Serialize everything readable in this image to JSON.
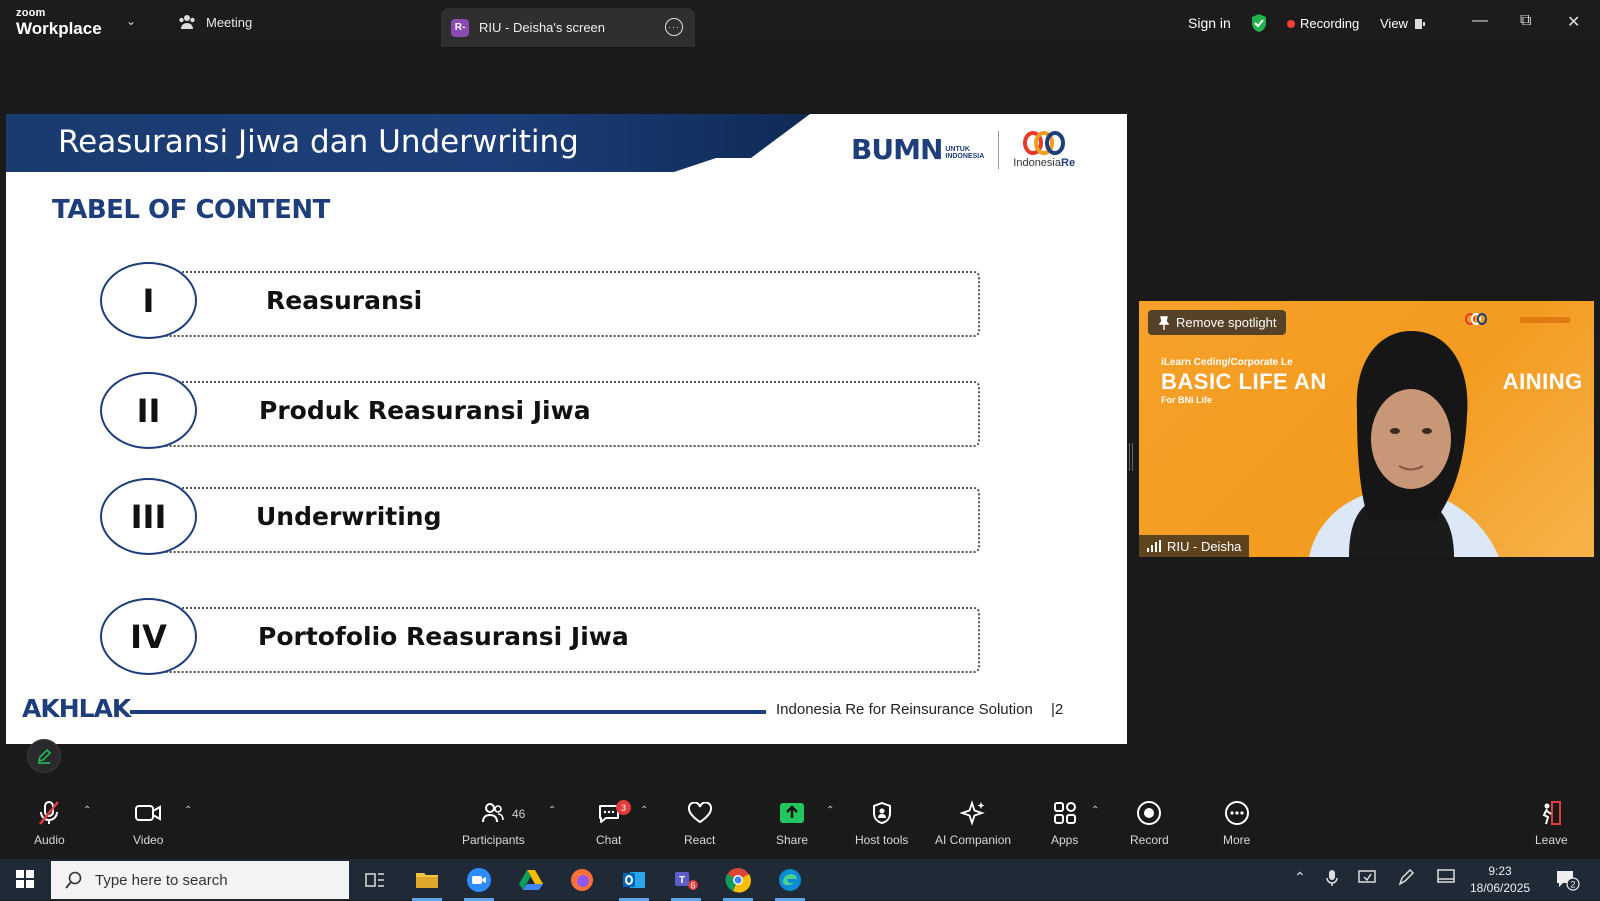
{
  "app": {
    "brand_small": "zoom",
    "brand_name": "Workplace",
    "meeting_tab_label": "Meeting",
    "share_tab_badge": "R-",
    "share_tab_label": "RIU - Deisha's screen",
    "sign_in_label": "Sign in",
    "recording_label": "Recording",
    "view_label": "View"
  },
  "slide": {
    "title": "Reasuransi Jiwa dan Underwriting",
    "logo_bumn": "BUMN",
    "logo_bumn_sub_1": "UNTUK",
    "logo_bumn_sub_2": "INDONESIA",
    "logo_indonesiare_1": "Indonesia",
    "logo_indonesiare_2": "Re",
    "toc_heading": "TABEL OF CONTENT",
    "items": [
      {
        "numeral": "I",
        "label": "Reasuransi"
      },
      {
        "numeral": "II",
        "label": "Produk Reasuransi Jiwa"
      },
      {
        "numeral": "III",
        "label": "Underwriting"
      },
      {
        "numeral": "IV",
        "label": "Portofolio Reasuransi Jiwa"
      }
    ],
    "footer_logo": "AKHLAK",
    "footer_text": "Indonesia Re for Reinsurance Solution",
    "footer_page": "|2"
  },
  "video": {
    "remove_spotlight_label": "Remove spotlight",
    "bg_small": "iLearn Ceding/Corporate Le",
    "bg_big_left": "BASIC LIFE AN",
    "bg_big_right": "AINING",
    "bg_for": "For BNI Life",
    "participant_name": "RIU - Deisha"
  },
  "toolbar": {
    "audio": "Audio",
    "video": "Video",
    "participants": "Participants",
    "participants_count": "46",
    "chat": "Chat",
    "chat_badge": "3",
    "react": "React",
    "share": "Share",
    "host_tools": "Host tools",
    "ai_companion": "AI Companion",
    "apps": "Apps",
    "record": "Record",
    "more": "More",
    "leave": "Leave"
  },
  "taskbar": {
    "search_placeholder": "Type here to search",
    "teams_badge": "6",
    "time": "9:23",
    "date": "18/06/2025",
    "notification_count": "2"
  },
  "colors": {
    "slide_navy": "#1d3e7a",
    "video_orange": "#f39b1f",
    "recording_red": "#ff3b3b",
    "share_green": "#22c55e"
  }
}
